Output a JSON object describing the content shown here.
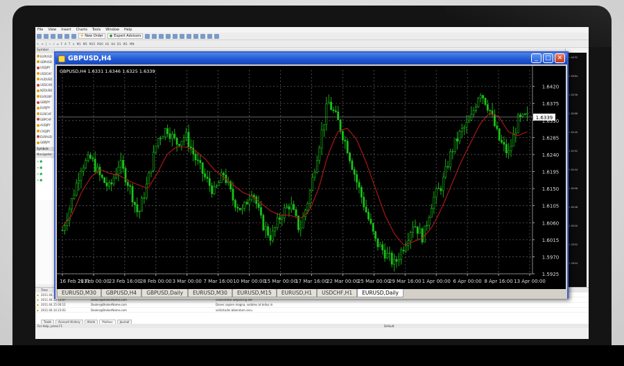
{
  "app": {
    "menu": [
      "File",
      "View",
      "Insert",
      "Charts",
      "Tools",
      "Window",
      "Help"
    ],
    "toolbar": {
      "new_order": "New Order",
      "expert_advisors": "Expert Advisors",
      "timeframes": [
        "M1",
        "M5",
        "M15",
        "M30",
        "H1",
        "H4",
        "D1",
        "W1",
        "MN"
      ]
    },
    "status_left": "For Help, press F1",
    "status_right": "Default"
  },
  "left_panel": {
    "header": "Symbol",
    "items": [
      "EURUSD",
      "GBPUSD",
      "USDJPY",
      "USDCHF",
      "AUDUSD",
      "USDCAD",
      "NZDUSD",
      "EURGBP",
      "GBPJPY",
      "EURJPY",
      "EURCHF",
      "GBPCHF",
      "AUDJPY",
      "CADJPY",
      "EURAUD",
      "GBPJPY"
    ],
    "tab": "Symbols",
    "navigator": "Navigator"
  },
  "chart_window": {
    "title": "GBPUSD,H4",
    "ohlc": "GBPUSD,H4  1.6331  1.6346  1.6325  1.6339",
    "current_price": "1.6339",
    "tabs": [
      "EURUSD,M30",
      "GBPUSD,H4",
      "GBPUSD,Daily",
      "EURUSD,M30",
      "EURUSD,M15",
      "EURUSD,H1",
      "USDCHF,H1",
      "EURUSD,Daily"
    ],
    "active_tab_index": 7
  },
  "chart_data": {
    "type": "candlestick",
    "symbol": "GBPUSD",
    "timeframe": "H4",
    "ylim": [
      1.5925,
      1.6445
    ],
    "y_ticks": [
      "1.6420",
      "1.6375",
      "1.6330",
      "1.6285",
      "1.6240",
      "1.6195",
      "1.6150",
      "1.6105",
      "1.6060",
      "1.6015",
      "1.5970",
      "1.5925"
    ],
    "x_ticks": [
      "16 Feb 2011",
      "21 Feb 00:00",
      "23 Feb 16:00",
      "28 Feb 00:00",
      "3 Mar 00:00",
      "7 Mar 16:00",
      "10 Mar 00:00",
      "15 Mar 00:00",
      "17 Mar 16:00",
      "22 Mar 00:00",
      "25 Mar 00:00",
      "29 Mar 16:00",
      "1 Apr 00:00",
      "6 Apr 00:00",
      "8 Apr 16:00",
      "13 Apr 00:00"
    ],
    "close_series": [
      1.604,
      1.612,
      1.621,
      1.623,
      1.618,
      1.615,
      1.622,
      1.616,
      1.608,
      1.617,
      1.628,
      1.631,
      1.627,
      1.629,
      1.623,
      1.618,
      1.614,
      1.619,
      1.612,
      1.609,
      1.615,
      1.606,
      1.602,
      1.608,
      1.611,
      1.604,
      1.613,
      1.626,
      1.638,
      1.633,
      1.626,
      1.617,
      1.609,
      1.601,
      1.598,
      1.595,
      1.6,
      1.606,
      1.602,
      1.612,
      1.616,
      1.625,
      1.63,
      1.633,
      1.641,
      1.636,
      1.628,
      1.624,
      1.633,
      1.6339
    ],
    "ma_series": [
      1.605,
      1.608,
      1.614,
      1.618,
      1.62,
      1.619,
      1.6185,
      1.617,
      1.616,
      1.615,
      1.619,
      1.624,
      1.626,
      1.626,
      1.625,
      1.623,
      1.62,
      1.618,
      1.616,
      1.614,
      1.613,
      1.611,
      1.609,
      1.608,
      1.608,
      1.607,
      1.609,
      1.615,
      1.624,
      1.63,
      1.631,
      1.628,
      1.622,
      1.615,
      1.608,
      1.603,
      1.6,
      1.601,
      1.602,
      1.605,
      1.61,
      1.616,
      1.622,
      1.627,
      1.632,
      1.635,
      1.634,
      1.63,
      1.629,
      1.63
    ],
    "colors": {
      "bull": "#19c219",
      "bear": "#19c219",
      "ma": "#b81919",
      "grid": "#5a5a5a",
      "background": "#000000"
    }
  },
  "terminal": {
    "columns": [
      "Time",
      "From",
      "Headline"
    ],
    "rows": [
      [
        "2011.04.15 13:27",
        "Dealer@BrokerName.com",
        "Lorem ipsum dolor sit amet"
      ],
      [
        "2011.04.15 13:07",
        "Dealer@BrokerName.com",
        "consectetur adipiscing elit"
      ],
      [
        "2011.04.15 00:12",
        "Dealer@BrokerName.com",
        "Donec sapien magna, sodales at tellus in"
      ],
      [
        "2011.04.14 23:03",
        "Dealer@BrokerName.com",
        "sollicitudin bibendum arcu"
      ]
    ],
    "tabs": [
      "Trade",
      "Account History",
      "Alerts",
      "Mailbox",
      "Journal"
    ],
    "active_tab": "Mailbox",
    "side_label": "Terminal"
  },
  "right_edge_prices": [
    "1.6432",
    "1.6384",
    "1.6336",
    "1.6288",
    "1.6240",
    "1.6192",
    "1.6144",
    "1.6096",
    "1.6048",
    "1.6000",
    "1.5952",
    "1.5904"
  ]
}
